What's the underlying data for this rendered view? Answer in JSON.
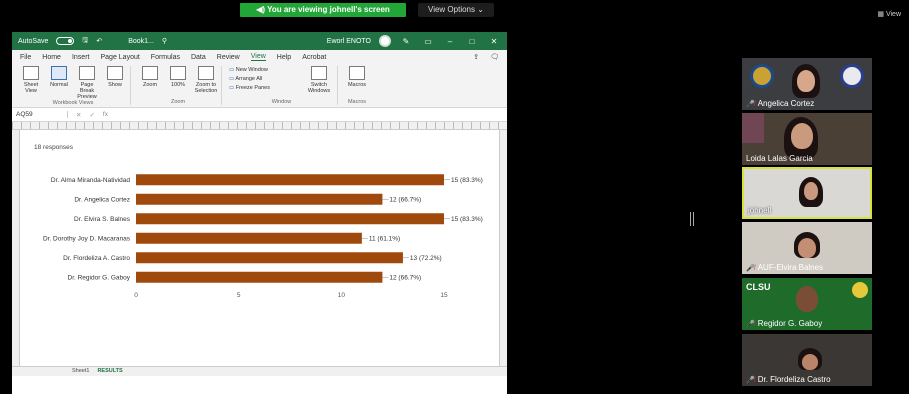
{
  "zoom": {
    "share_banner": "You are viewing johnell's screen",
    "view_options": "View Options ⌄",
    "view_button": "View"
  },
  "excel": {
    "titlebar": {
      "autosave": "AutoSave",
      "book": "Book1...",
      "user": "Eworl ENOTO"
    },
    "menu": [
      "File",
      "Home",
      "Insert",
      "Page Layout",
      "Formulas",
      "Data",
      "Review",
      "View",
      "Help",
      "Acrobat"
    ],
    "active_menu": "View",
    "ribbon": {
      "sheet_view": "Sheet View",
      "normal": "Normal",
      "page_break_preview": "Page Break Preview",
      "show": "Show",
      "zoom": "Zoom",
      "zoom_100": "100%",
      "zoom_to_selection": "Zoom to Selection",
      "new_window": "New Window",
      "arrange_all": "Arrange All",
      "freeze_panes": "Freeze Panes",
      "switch_windows": "Switch Windows",
      "macros": "Macros",
      "group_workbook_views": "Workbook Views",
      "group_zoom": "Zoom",
      "group_window": "Window",
      "group_macros": "Macros"
    },
    "name_box": "AQ59",
    "fx": "fx",
    "responses": "18 responses",
    "sheet_tabs": [
      "Sheet1",
      "RESULTS"
    ]
  },
  "chart_data": {
    "type": "bar",
    "orientation": "horizontal",
    "categories": [
      "Dr. Alma Miranda-Natividad",
      "Dr. Angelica Cortez",
      "Dr. Elvira S. Balnes",
      "Dr. Dorothy Joy D. Macaranas",
      "Dr. Flordeliza A. Castro",
      "Dr. Regidor G. Gaboy"
    ],
    "values": [
      15,
      12,
      15,
      11,
      13,
      12
    ],
    "data_labels": [
      "15 (83.3%)",
      "12 (66.7%)",
      "15 (83.3%)",
      "11 (61.1%)",
      "13 (72.2%)",
      "12 (66.7%)"
    ],
    "xlim": [
      0,
      15
    ],
    "xticks": [
      "0",
      "5",
      "10",
      "15"
    ],
    "bar_color": "#a0490d"
  },
  "participants": [
    {
      "name": "Angelica Cortez",
      "muted": true
    },
    {
      "name": "Loida Lalas Garcia",
      "muted": false
    },
    {
      "name": "johnell",
      "muted": false
    },
    {
      "name": "AUF-Elvira Balnes",
      "muted": true
    },
    {
      "name": "Regidor G. Gaboy",
      "muted": true
    },
    {
      "name": "Dr. Flordeliza Castro",
      "muted": true
    }
  ],
  "colors": {
    "excel_green": "#217346",
    "zoom_banner": "#23a638",
    "active_speaker": "#d8e23a"
  }
}
